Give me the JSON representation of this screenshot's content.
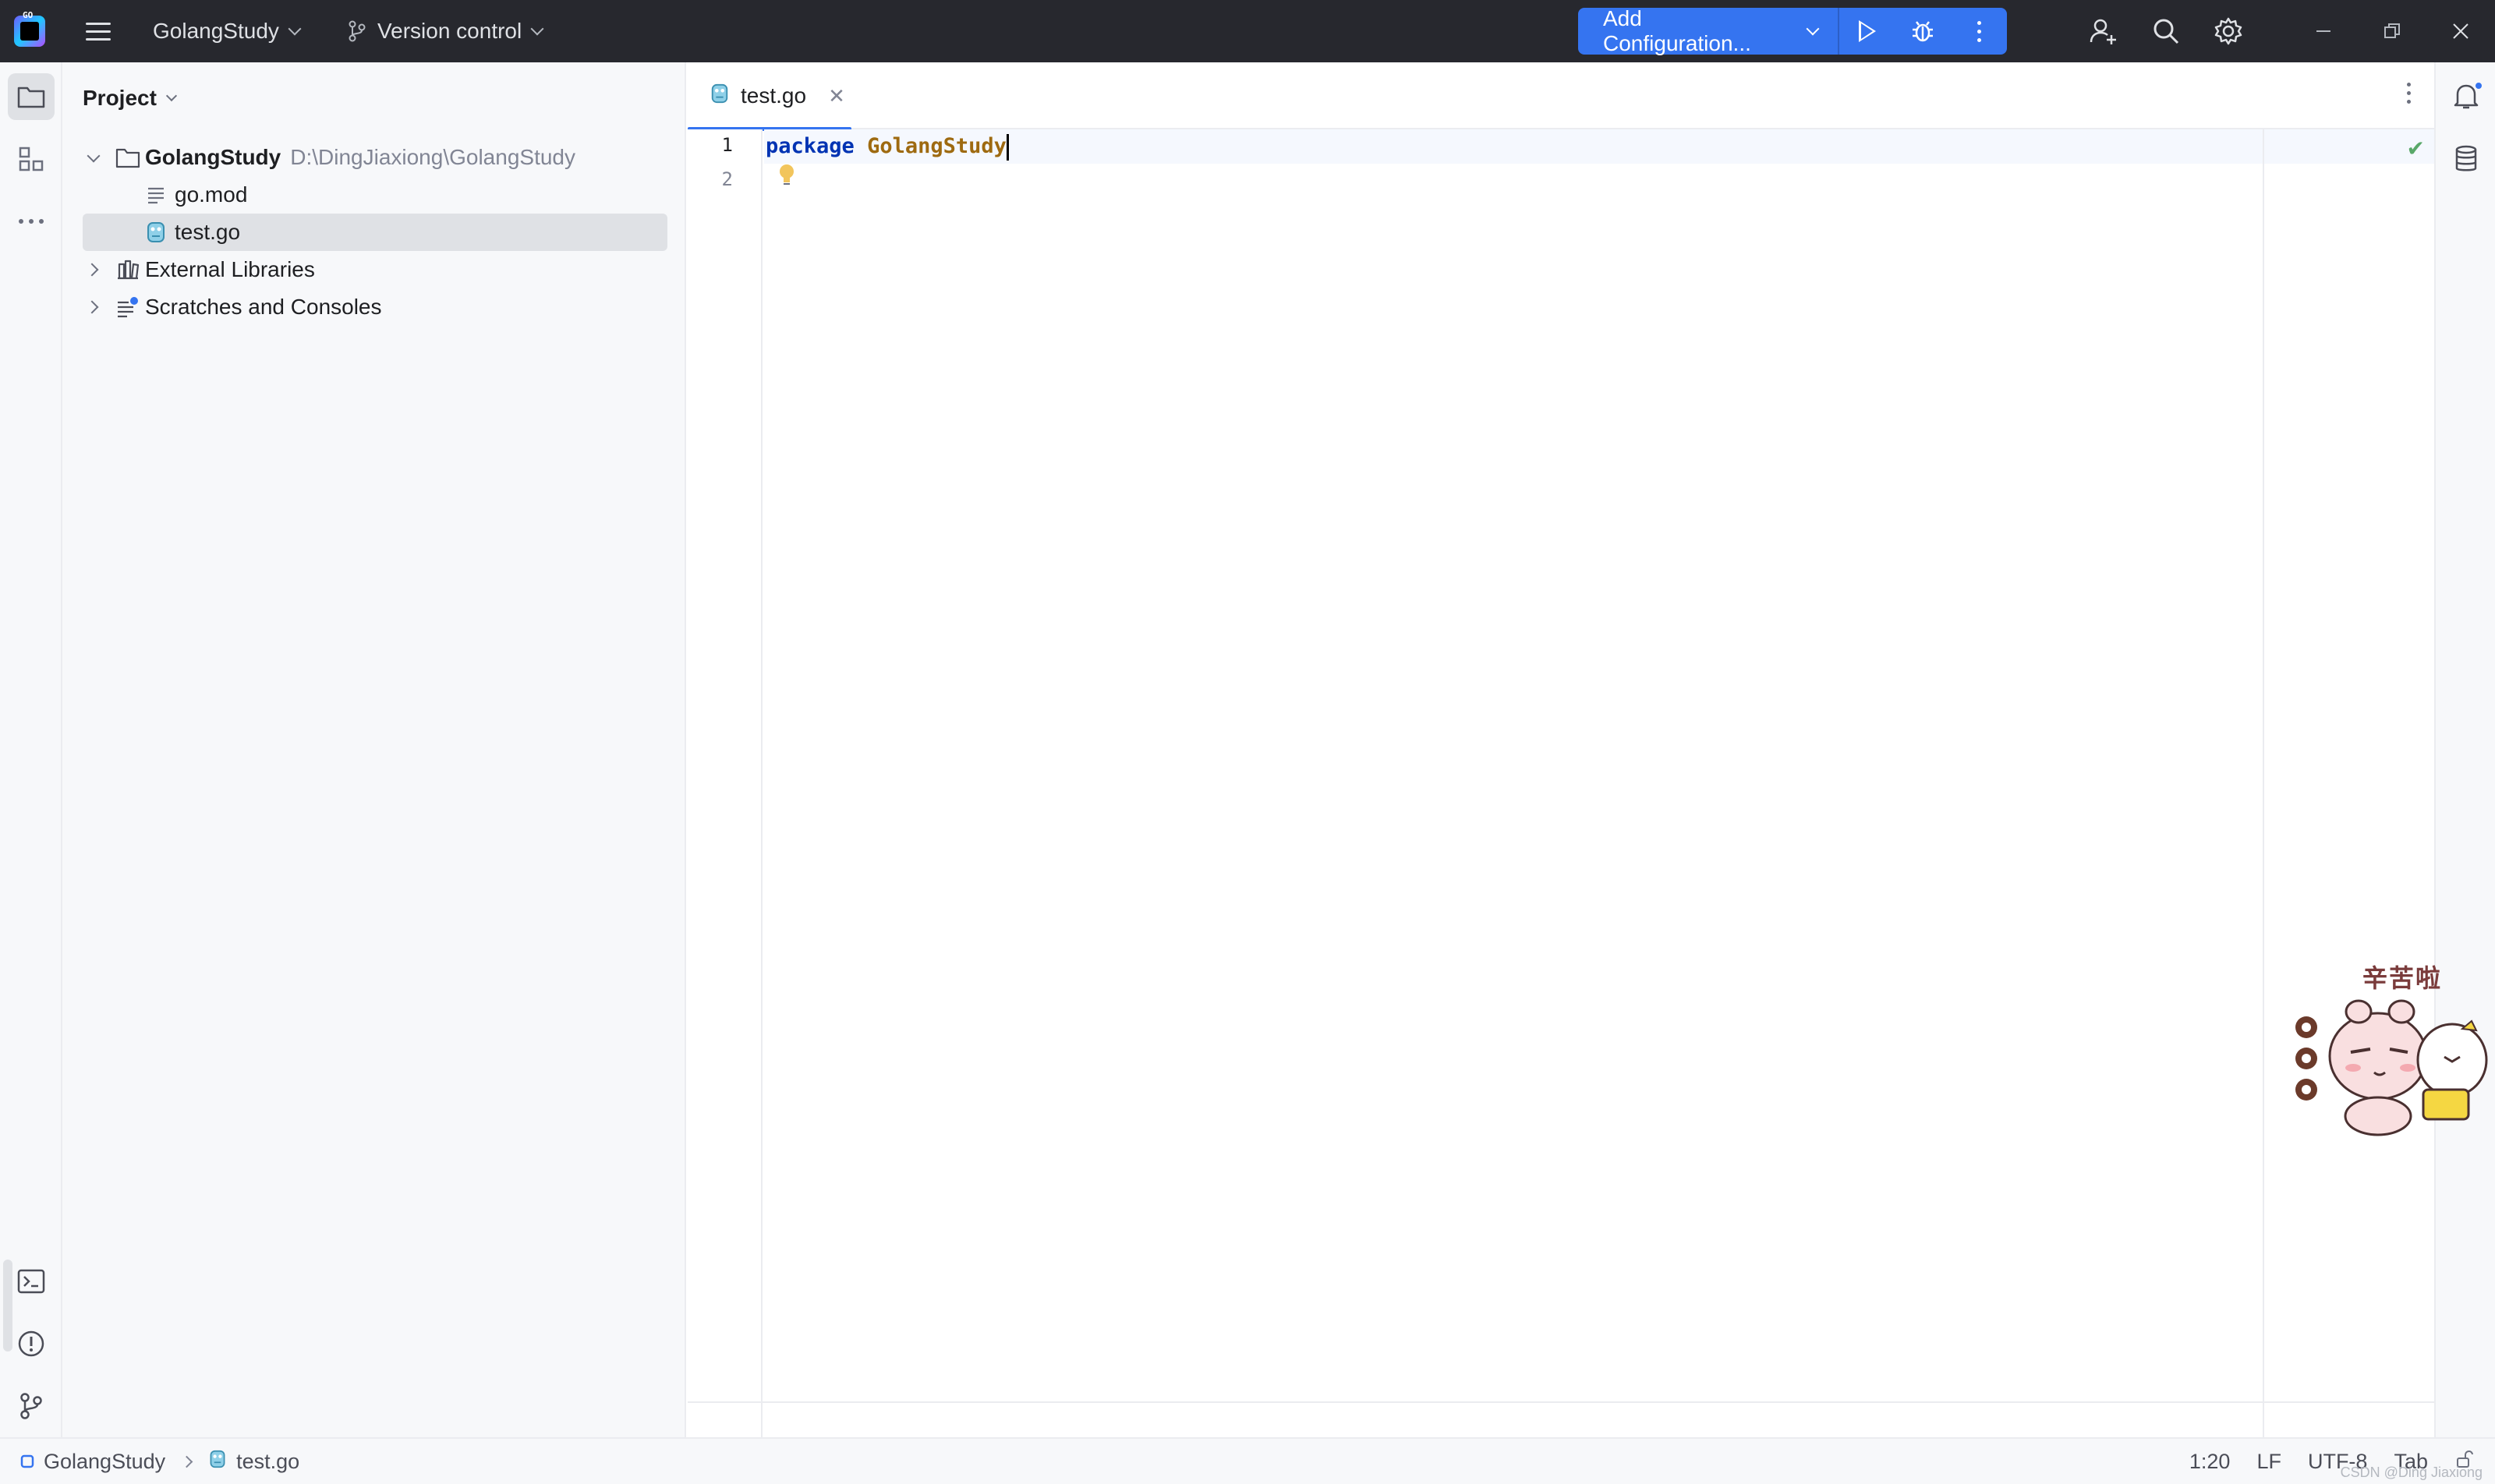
{
  "titlebar": {
    "project_name": "GolangStudy",
    "vcs_label": "Version control",
    "run_config_label": "Add Configuration..."
  },
  "project_panel": {
    "title": "Project",
    "tree": [
      {
        "label": "GolangStudy",
        "hint": "D:\\DingJiaxiong\\GolangStudy",
        "icon": "folder-icon",
        "expanded": true
      },
      {
        "label": "go.mod",
        "icon": "file-text-icon"
      },
      {
        "label": "test.go",
        "icon": "go-file-icon",
        "selected": true
      },
      {
        "label": "External Libraries",
        "icon": "library-icon",
        "expanded": false
      },
      {
        "label": "Scratches and Consoles",
        "icon": "scratches-icon",
        "expanded": false
      }
    ]
  },
  "editor": {
    "tab_label": "test.go",
    "line_numbers": [
      "1",
      "2"
    ],
    "code_keyword": "package",
    "code_package": "GolangStudy"
  },
  "sticker": {
    "text": "辛苦啦"
  },
  "statusbar": {
    "crumb_project": "GolangStudy",
    "crumb_file": "test.go",
    "position": "1:20",
    "line_ending": "LF",
    "encoding": "UTF-8",
    "indent": "Tab",
    "watermark": "CSDN @Ding Jiaxiong"
  },
  "colors": {
    "accent": "#3574f0",
    "titlebar_bg": "#27282e",
    "keyword": "#0033b3",
    "package_name": "#9e6a10",
    "ok_check": "#59a869"
  }
}
